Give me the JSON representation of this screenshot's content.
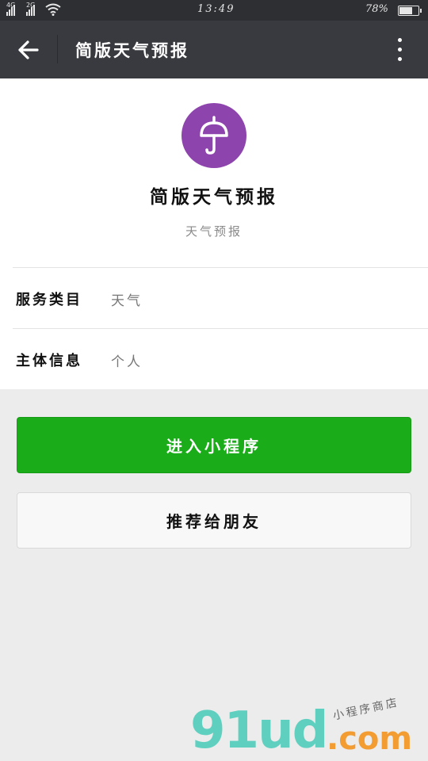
{
  "status_bar": {
    "network_1": "4G",
    "network_2": "2G",
    "time": "13:49",
    "battery_percent": "78%",
    "battery_level": 0.78
  },
  "nav": {
    "title": "简版天气预报",
    "back_icon": "arrow-left-icon",
    "more_icon": "more-vertical-icon"
  },
  "profile": {
    "avatar_icon": "umbrella-icon",
    "avatar_color": "#8e44ad",
    "name": "简版天气预报",
    "description": "天气预报"
  },
  "info": [
    {
      "label": "服务类目",
      "value": "天气"
    },
    {
      "label": "主体信息",
      "value": "个人"
    }
  ],
  "buttons": {
    "enter_label": "进入小程序",
    "enter_color": "#1aad19",
    "share_label": "推荐给朋友"
  },
  "watermark": {
    "logo": "91ud",
    "domain": ".com",
    "tagline": "小程序商店"
  }
}
